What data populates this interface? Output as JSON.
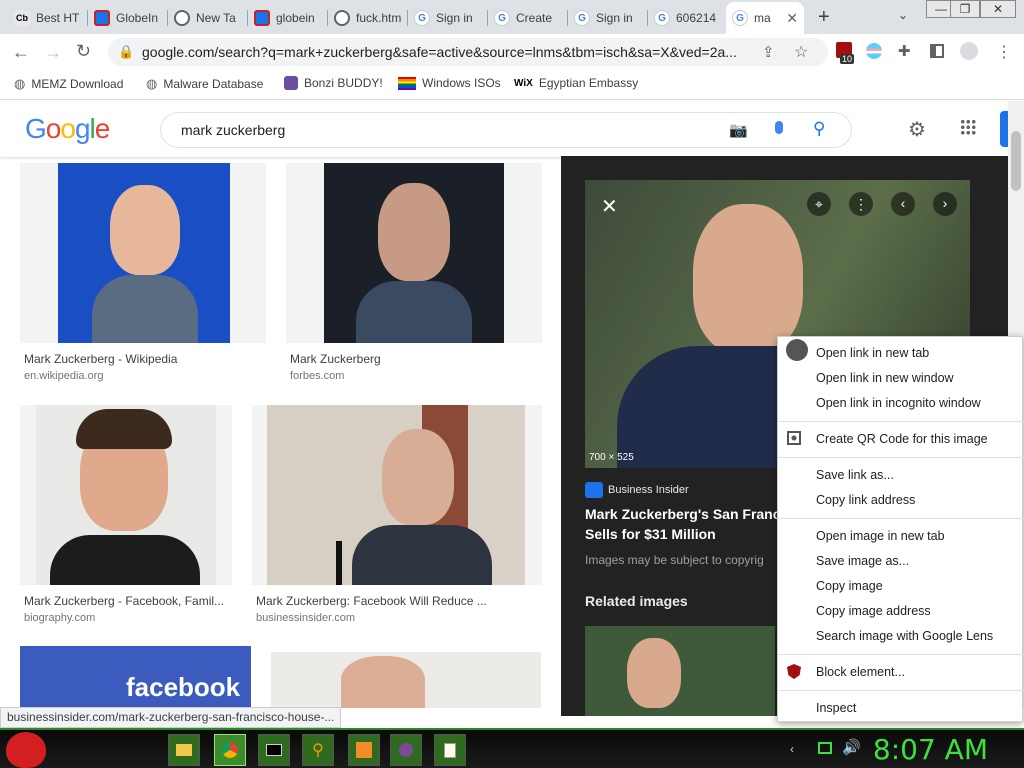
{
  "tabs": [
    {
      "title": "Best HT",
      "icon": "cb-favicon"
    },
    {
      "title": "GlobeIn",
      "icon": "globe-favicon"
    },
    {
      "title": "New Ta",
      "icon": "chrome-favicon"
    },
    {
      "title": "globein",
      "icon": "globe-favicon"
    },
    {
      "title": "fuck.htm",
      "icon": "world-favicon"
    },
    {
      "title": "Sign in",
      "icon": "google-favicon"
    },
    {
      "title": "Create",
      "icon": "google-favicon"
    },
    {
      "title": "Sign in",
      "icon": "google-favicon"
    },
    {
      "title": "606214",
      "icon": "google-favicon"
    },
    {
      "title": "ma",
      "icon": "google-favicon",
      "active": true
    }
  ],
  "window_controls": {
    "minimize": "—",
    "restore": "❐",
    "close": "✕"
  },
  "new_tab_label": "+",
  "url": "google.com/search?q=mark+zuckerberg&safe=active&source=lnms&tbm=isch&sa=X&ved=2a...",
  "extension_badge": "10",
  "bookmarks": [
    {
      "label": "MEMZ Download",
      "icon": "globe-icon"
    },
    {
      "label": "Malware Database",
      "icon": "globe-icon"
    },
    {
      "label": "Bonzi BUDDY!",
      "icon": "bonzi-icon"
    },
    {
      "label": "Windows ISOs",
      "icon": "rainbow-flag-icon"
    },
    {
      "label": "Egyptian Embassy",
      "icon": "wix-icon"
    }
  ],
  "google": {
    "logo_letters": [
      "G",
      "o",
      "o",
      "g",
      "l",
      "e"
    ],
    "logo_colors": [
      "#4285f4",
      "#ea4335",
      "#fbbc05",
      "#4285f4",
      "#34a853",
      "#ea4335"
    ],
    "query": "mark zuckerberg"
  },
  "results": [
    {
      "caption": "Mark Zuckerberg - Wikipedia",
      "source": "en.wikipedia.org"
    },
    {
      "caption": "Mark Zuckerberg",
      "source": "forbes.com"
    },
    {
      "caption": "Mark Zuckerberg - Facebook, Famil...",
      "source": "biography.com"
    },
    {
      "caption": "Mark Zuckerberg: Facebook Will Reduce ...",
      "source": "businessinsider.com"
    },
    {
      "banner_text": "facebook"
    }
  ],
  "preview": {
    "dimensions": "700 × 525",
    "source_name": "Business Insider",
    "title_line1": "Mark Zuckerberg's San Franc",
    "title_line2": "Sells for $31 Million",
    "copyright": "Images may be subject to copyrig",
    "related": "Related images"
  },
  "context_menu": [
    {
      "label": "Open link in new tab",
      "group": 1
    },
    {
      "label": "Open link in new window",
      "group": 1
    },
    {
      "label": "Open link in incognito window",
      "group": 1
    },
    {
      "label": "Create QR Code for this image",
      "group": 2
    },
    {
      "label": "Save link as...",
      "group": 3
    },
    {
      "label": "Copy link address",
      "group": 3
    },
    {
      "label": "Open image in new tab",
      "group": 4
    },
    {
      "label": "Save image as...",
      "group": 4
    },
    {
      "label": "Copy image",
      "group": 4
    },
    {
      "label": "Copy image address",
      "group": 4
    },
    {
      "label": "Search image with Google Lens",
      "group": 4
    },
    {
      "label": "Block element...",
      "group": 5
    },
    {
      "label": "Inspect",
      "group": 6
    }
  ],
  "status_url": "businessinsider.com/mark-zuckerberg-san-francisco-house-...",
  "clock": "8:07 AM",
  "colors": {
    "accent": "#1a73e8",
    "taskbar_green": "#3ce23c",
    "preview_bg": "#222222"
  }
}
